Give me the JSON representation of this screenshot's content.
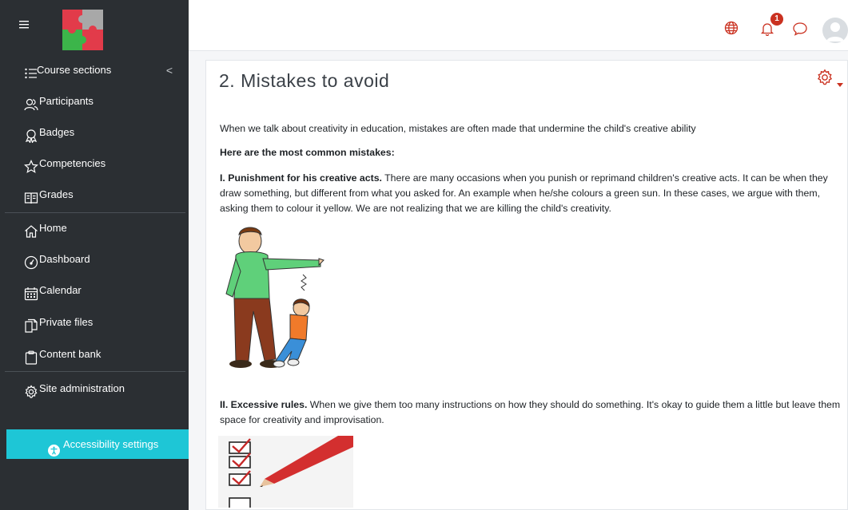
{
  "header": {
    "menu_icon": "hamburger-icon",
    "logo_name": "puzzle-logo",
    "icons": [
      "globe-icon",
      "bell-icon",
      "chat-icon",
      "user-avatar-icon"
    ],
    "notification_count": "1"
  },
  "sidebar": {
    "items": [
      {
        "label": "Course sections",
        "icon": "list-icon"
      },
      {
        "label": "Participants",
        "icon": "users-icon"
      },
      {
        "label": "Badges",
        "icon": "badge-icon"
      },
      {
        "label": "Competencies",
        "icon": "star-icon"
      },
      {
        "label": "Grades",
        "icon": "grades-icon"
      },
      {
        "label": "Home",
        "icon": "home-icon"
      },
      {
        "label": "Dashboard",
        "icon": "gauge-icon"
      },
      {
        "label": "Calendar",
        "icon": "calendar-icon"
      },
      {
        "label": "Private files",
        "icon": "files-icon"
      },
      {
        "label": "Content bank",
        "icon": "clipboard-icon"
      },
      {
        "label": "Site administration",
        "icon": "gear-icon"
      }
    ],
    "collapse_glyph": "<",
    "accessibility_label": "Accessibility settings"
  },
  "main": {
    "title": "2. Mistakes to avoid",
    "intro": "When we talk about creativity in education, mistakes are often made that undermine the child's creative ability",
    "subheading": "Here are the most common mistakes:",
    "mistake1_title": "I. Punishment for his creative acts.",
    "mistake1_text": " There are many occasions when you punish or reprimand children's creative acts. It can be when they draw something, but different from what you asked for. An example when he/she colours a green sun. In these cases, we argue with them, asking them to colour it yellow. We are not realizing that we are killing the child's creativity.",
    "mistake2_title": "II.  Excessive rules.",
    "mistake2_text": " When we give them too many instructions on how they should do something. It's okay to guide them a little but leave them space for creativity and improvisation."
  },
  "colors": {
    "sidebar_bg": "#2b2f33",
    "accent_cyan": "#1ec6d6",
    "accent_red": "#ca3120"
  }
}
